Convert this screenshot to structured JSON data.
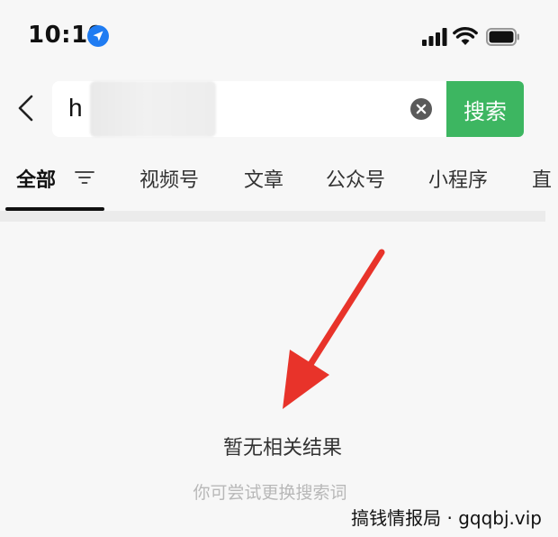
{
  "status_bar": {
    "time": "10:19"
  },
  "search": {
    "value": "h",
    "button_label": "搜索"
  },
  "tabs": [
    {
      "label": "全部",
      "active": true
    },
    {
      "label": "视频号"
    },
    {
      "label": "文章"
    },
    {
      "label": "公众号"
    },
    {
      "label": "小程序"
    },
    {
      "label": "直"
    }
  ],
  "empty_state": {
    "title": "暂无相关结果",
    "hint": "你可尝试更换搜索词"
  },
  "watermark": "搞钱情报局 · gqqbj.vip",
  "colors": {
    "accent_green": "#3db661",
    "annotation_red": "#e8332a",
    "background": "#f7f7f7"
  },
  "icons": [
    "location-arrow-icon",
    "signal-icon",
    "wifi-icon",
    "battery-icon",
    "back-icon",
    "clear-icon",
    "filter-icon"
  ]
}
